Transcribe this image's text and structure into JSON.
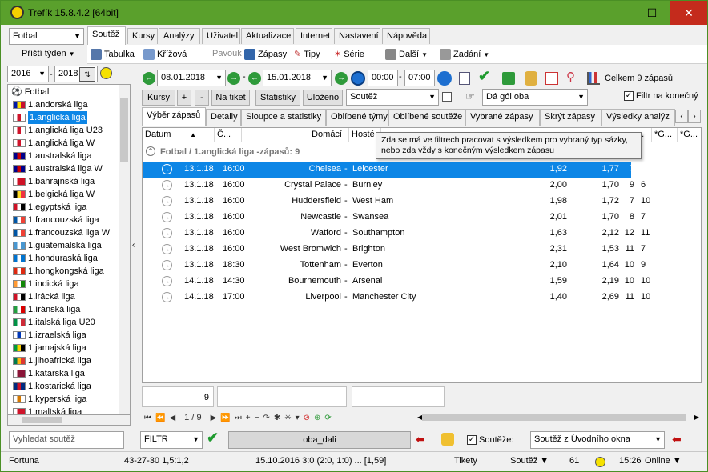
{
  "window": {
    "title": "Trefík 15.8.4.2 [64bit]",
    "minimize": "—",
    "maximize": "☐",
    "close": "✕"
  },
  "left": {
    "sport_select": "Fotbal",
    "period_select": "Příští týden",
    "year_from": "2016",
    "year_to": "2018",
    "tree_root": "Fotbal",
    "leagues": [
      {
        "name": "1.andorská liga",
        "colors": [
          "#0018a8",
          "#fedf00",
          "#c7102e"
        ]
      },
      {
        "name": "1.anglická liga",
        "colors": [
          "#ffffff",
          "#cf142b",
          "#ffffff"
        ]
      },
      {
        "name": "1.anglická liga U23",
        "colors": [
          "#ffffff",
          "#cf142b",
          "#ffffff"
        ]
      },
      {
        "name": "1.anglická liga W",
        "colors": [
          "#ffffff",
          "#cf142b",
          "#ffffff"
        ]
      },
      {
        "name": "1.australská liga",
        "colors": [
          "#00008b",
          "#cc0000",
          "#00008b"
        ]
      },
      {
        "name": "1.australská liga W",
        "colors": [
          "#00008b",
          "#cc0000",
          "#00008b"
        ]
      },
      {
        "name": "1.bahrajnská liga",
        "colors": [
          "#ffffff",
          "#ce1126",
          "#ce1126"
        ]
      },
      {
        "name": "1.belgická liga W",
        "colors": [
          "#000000",
          "#fdda24",
          "#ef3340"
        ]
      },
      {
        "name": "1.egyptská liga",
        "colors": [
          "#ce1126",
          "#ffffff",
          "#000000"
        ]
      },
      {
        "name": "1.francouzská liga",
        "colors": [
          "#0055a4",
          "#ffffff",
          "#ef4135"
        ]
      },
      {
        "name": "1.francouzská liga W",
        "colors": [
          "#0055a4",
          "#ffffff",
          "#ef4135"
        ]
      },
      {
        "name": "1.guatemalská liga",
        "colors": [
          "#4997d0",
          "#ffffff",
          "#4997d0"
        ]
      },
      {
        "name": "1.honduraská liga",
        "colors": [
          "#0073cf",
          "#ffffff",
          "#0073cf"
        ]
      },
      {
        "name": "1.hongkongská liga",
        "colors": [
          "#de2910",
          "#ffffff",
          "#de2910"
        ]
      },
      {
        "name": "1.indická liga",
        "colors": [
          "#ff9933",
          "#ffffff",
          "#138808"
        ]
      },
      {
        "name": "1.irácká liga",
        "colors": [
          "#ce1126",
          "#ffffff",
          "#000000"
        ]
      },
      {
        "name": "1.íránská liga",
        "colors": [
          "#239f40",
          "#ffffff",
          "#da0000"
        ]
      },
      {
        "name": "1.italská liga U20",
        "colors": [
          "#009246",
          "#ffffff",
          "#ce2b37"
        ]
      },
      {
        "name": "1.izraelská liga",
        "colors": [
          "#ffffff",
          "#0038b8",
          "#ffffff"
        ]
      },
      {
        "name": "1.jamajská liga",
        "colors": [
          "#009b3a",
          "#fed100",
          "#000000"
        ]
      },
      {
        "name": "1.jihoafrická liga",
        "colors": [
          "#007a4d",
          "#ffb612",
          "#de3831"
        ]
      },
      {
        "name": "1.katarská liga",
        "colors": [
          "#ffffff",
          "#8a1538",
          "#8a1538"
        ]
      },
      {
        "name": "1.kostarická liga",
        "colors": [
          "#002b7f",
          "#ce1126",
          "#002b7f"
        ]
      },
      {
        "name": "1.kyperská liga",
        "colors": [
          "#ffffff",
          "#d57800",
          "#ffffff"
        ]
      },
      {
        "name": "1.maltská liga",
        "colors": [
          "#ffffff",
          "#cf142b",
          "#cf142b"
        ]
      }
    ],
    "selected_index": 1,
    "search_placeholder": "Vyhledat soutěž"
  },
  "menu_tabs": [
    "Soutěž",
    "Kursy",
    "Analýzy",
    "Uživatel",
    "Aktualizace",
    "Internet",
    "Nastavení",
    "Nápověda"
  ],
  "toolbar1": [
    "Tabulka",
    "Křížová",
    "Pavouk",
    "Zápasy",
    "Tipy",
    "Série",
    "Další",
    "Zadání"
  ],
  "toolbar2": {
    "date_from": "08.01.2018",
    "date_to": "15.01.2018",
    "time_from": "00:00",
    "time_to": "07:00",
    "total": "Celkem 9 zápasů"
  },
  "toolbar3": {
    "kursy": "Kursy",
    "plus": "+",
    "minus": "-",
    "na_tiket": "Na tiket",
    "statistiky": "Statistiky",
    "ulozeno": "Uloženo",
    "soutez_select": "Soutěž",
    "bet_select": "Dá gól oba",
    "filtr_konecny": "Filtr na konečný"
  },
  "subtabs": [
    "Výběr zápasů",
    "Detaily",
    "Sloupce a statistiky",
    "Oblíbené týmy",
    "Oblíbené soutěže",
    "Vybrané zápasy",
    "Skrýt zápasy",
    "Výsledky analýz"
  ],
  "columns": {
    "datum": "Datum",
    "cas": "Č...",
    "domaci": "Domácí",
    "hoste": "Hosté",
    "c1": "...",
    "c2": "*G...",
    "c3": "*G..."
  },
  "group_header": "Fotbal / 1.anglická liga -zápasů: 9",
  "matches": [
    {
      "date": "13.1.18",
      "time": "16:00",
      "home": "Chelsea",
      "away": "Leicester",
      "o1": "1,92",
      "o2": "1,77",
      "n1": "7",
      "n2": "13"
    },
    {
      "date": "13.1.18",
      "time": "16:00",
      "home": "Crystal Palace",
      "away": "Burnley",
      "o1": "2,00",
      "o2": "1,70",
      "n1": "9",
      "n2": "6"
    },
    {
      "date": "13.1.18",
      "time": "16:00",
      "home": "Huddersfield",
      "away": "West Ham",
      "o1": "1,98",
      "o2": "1,72",
      "n1": "7",
      "n2": "10"
    },
    {
      "date": "13.1.18",
      "time": "16:00",
      "home": "Newcastle",
      "away": "Swansea",
      "o1": "2,01",
      "o2": "1,70",
      "n1": "8",
      "n2": "7"
    },
    {
      "date": "13.1.18",
      "time": "16:00",
      "home": "Watford",
      "away": "Southampton",
      "o1": "1,63",
      "o2": "2,12",
      "n1": "12",
      "n2": "11"
    },
    {
      "date": "13.1.18",
      "time": "16:00",
      "home": "West Bromwich",
      "away": "Brighton",
      "o1": "2,31",
      "o2": "1,53",
      "n1": "11",
      "n2": "7"
    },
    {
      "date": "13.1.18",
      "time": "18:30",
      "home": "Tottenham",
      "away": "Everton",
      "o1": "2,10",
      "o2": "1,64",
      "n1": "10",
      "n2": "9"
    },
    {
      "date": "14.1.18",
      "time": "14:30",
      "home": "Bournemouth",
      "away": "Arsenal",
      "o1": "1,59",
      "o2": "2,19",
      "n1": "10",
      "n2": "10"
    },
    {
      "date": "14.1.18",
      "time": "17:00",
      "home": "Liverpool",
      "away": "Manchester City",
      "o1": "1,40",
      "o2": "2,69",
      "n1": "11",
      "n2": "10"
    }
  ],
  "tooltip": {
    "line1": "Zda se má ve filtrech pracovat s výsledkem pro vybraný typ sázky,",
    "line2": "nebo zda vždy s konečným výsledkem zápasu"
  },
  "footer_count": "9",
  "pager": "1 / 9",
  "bottom": {
    "filtr": "FILTR",
    "filter_name": "oba_dali",
    "soutez_label": "Soutěže:",
    "soutez_select": "Soutěž z Úvodního okna"
  },
  "statusbar": {
    "bookmaker": "Fortuna",
    "record": "43-27-30  1,5:1,2",
    "last": "15.10.2016 3:0 (2:0, 1:0) ... [1,59]",
    "tikety": "Tikety",
    "soutez": "Soutěž ▼",
    "num": "61",
    "time": "15:26",
    "online": "Online ▼"
  }
}
